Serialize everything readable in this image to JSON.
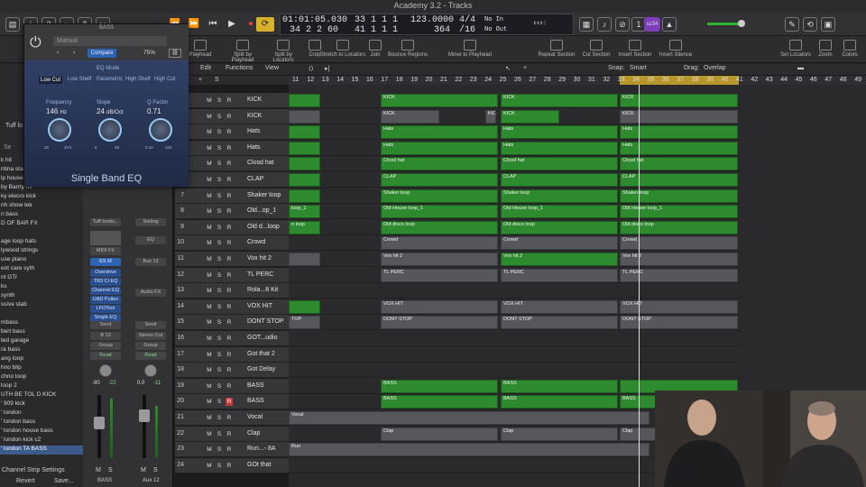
{
  "window": {
    "title": "Academy 3.2 - Tracks"
  },
  "transport": {
    "rewind": "⏪",
    "forward": "⏩",
    "to_start": "⏮",
    "play": "▶",
    "record": "●",
    "cycle": "⟳",
    "smpte": "01:01:05.030",
    "smpte_sub": "34 2 2 60",
    "bar_a": "33 1 1 1",
    "bar_b": "41 1 1 1",
    "tempo": "123.0000",
    "tempo_sub": "364",
    "sig": "4/4",
    "sig_sub": "/16",
    "in": "No In",
    "out": "No Out",
    "badge": "sz34"
  },
  "toolbar": {
    "tools": [
      "Playhead",
      "Split by Playhead",
      "Split by Locators",
      "Crop",
      "Stretch to Locators",
      "Join",
      "Bounce Regions",
      "Move to Playhead",
      "Repeat Section",
      "Cut Section",
      "Insert Section",
      "Insert Silence",
      "Set Locators",
      "Zoom",
      "Colors"
    ]
  },
  "library": {
    "items": [
      "k hit",
      "ntina stab",
      "lp house",
      "by Barrty riff",
      "ky elecro kick",
      "nh show tek",
      "n bass",
      "D OF BAR FX",
      "",
      "age loop hats",
      "lywood strings",
      "use piano",
      "ent care syth",
      "nt GTr",
      "ks",
      "synth",
      "ssive stab",
      "",
      "mbass",
      "bert bass",
      "ted garage",
      "ra bass",
      "ang loop",
      "hno blip",
      "chno loop",
      "loop 2",
      "UTH BE TOL D KICK",
      "' 909 kick",
      "' london",
      "' london bass",
      "' london house bass",
      "' london kick c2",
      "' london TA BASS"
    ],
    "selected_index": 32,
    "tuff_label": "Tuff lo",
    "search_label": "Se",
    "footer": "Channel Strip Settings",
    "revert": "Revert",
    "save": "Save..."
  },
  "inspector": {
    "left": {
      "preset": "Tuff londo...",
      "midi": "MIDI FX",
      "inst": "ES M",
      "plugins": [
        "Overdrive",
        "TR3 Ci EQ",
        "Channel EQ",
        "UAD Pultec",
        "LFOTool",
        "Single EQ"
      ],
      "send": "Send",
      "bus": "B 13",
      "group": "Group",
      "auto": "Read",
      "vol": "-90",
      "pan": "-22",
      "name": "BASS"
    },
    "right": {
      "setting": "Setting",
      "eq": "EQ",
      "bus": "Bus 13",
      "audio_fx": "Audio FX",
      "send": "Send",
      "output": "Stereo Out",
      "group": "Group",
      "auto": "Read",
      "vol": "0.0",
      "pan": "-11",
      "name": "Aux 12"
    }
  },
  "plugin": {
    "title": "BASS",
    "preset": "Manual",
    "compare": "Compare",
    "zoom": "75%",
    "eq_mode_label": "EQ Mode",
    "modes": [
      "Low Cut",
      "Low Shelf",
      "Parametric",
      "High Shelf",
      "High Cut"
    ],
    "params": [
      {
        "label": "Frequency",
        "value": "146",
        "unit": "Hz",
        "min": "20",
        "max": "20 k"
      },
      {
        "label": "Slope",
        "value": "24",
        "unit": "dB/Oct",
        "min": "6",
        "max": "48"
      },
      {
        "label": "Q Factor",
        "value": "0.71",
        "unit": "",
        "min": "0.10",
        "max": "100"
      }
    ],
    "name": "Single Band EQ"
  },
  "edit_bar": {
    "items": [
      "Edit",
      "Functions",
      "View"
    ],
    "snap_label": "Snap:",
    "snap_value": "Smart",
    "drag_label": "Drag:",
    "drag_value": "Overlap"
  },
  "ruler": {
    "bars": [
      "11",
      "12",
      "13",
      "14",
      "15",
      "16",
      "17",
      "18",
      "19",
      "20",
      "21",
      "22",
      "23",
      "24",
      "25",
      "26",
      "27",
      "28",
      "29",
      "30",
      "31",
      "32",
      "33",
      "34",
      "35",
      "36",
      "37",
      "38",
      "39",
      "40",
      "41",
      "42",
      "43",
      "44",
      "45",
      "46",
      "47",
      "48",
      "49"
    ]
  },
  "tracks": [
    {
      "num": "1",
      "name": "KICK",
      "rec": false,
      "regions": [
        {
          "text": "",
          "gray": false
        },
        {
          "text": "KICK",
          "gray": false
        },
        {
          "text": "KICK",
          "gray": false
        },
        {
          "text": "KICK",
          "gray": false
        }
      ]
    },
    {
      "num": "2",
      "name": "KICK",
      "rec": false,
      "regions": [
        {
          "text": "",
          "gray": true
        },
        {
          "text": "KICK",
          "gray": true
        },
        {
          "text": "KICK",
          "gray": true
        },
        {
          "text": "KICK",
          "gray": false
        },
        {
          "text": "KICK",
          "gray": true
        }
      ]
    },
    {
      "num": "3",
      "name": "Hats",
      "rec": false,
      "regions": [
        {
          "text": "",
          "gray": false
        },
        {
          "text": "Hats",
          "gray": false
        },
        {
          "text": "Hats",
          "gray": false
        },
        {
          "text": "Hats",
          "gray": false
        }
      ]
    },
    {
      "num": "4",
      "name": "Hats",
      "rec": false,
      "regions": [
        {
          "text": "",
          "gray": false
        },
        {
          "text": "Hats",
          "gray": false
        },
        {
          "text": "Hats",
          "gray": false
        },
        {
          "text": "Hats",
          "gray": false
        }
      ]
    },
    {
      "num": "5",
      "name": "Closd hat",
      "rec": false,
      "regions": [
        {
          "text": "",
          "gray": false
        },
        {
          "text": "Closd hat",
          "gray": false
        },
        {
          "text": "Closd hat",
          "gray": false
        },
        {
          "text": "Closd hat",
          "gray": false
        }
      ]
    },
    {
      "num": "6",
      "name": "CLAP",
      "rec": false,
      "regions": [
        {
          "text": "",
          "gray": false
        },
        {
          "text": "CLAP",
          "gray": false
        },
        {
          "text": "CLAP",
          "gray": false
        },
        {
          "text": "CLAP",
          "gray": false
        }
      ]
    },
    {
      "num": "7",
      "name": "Shaker loop",
      "rec": false,
      "regions": [
        {
          "text": "",
          "gray": false
        },
        {
          "text": "Shaker loop",
          "gray": false
        },
        {
          "text": "Shaker loop",
          "gray": false
        },
        {
          "text": "Shaker loop",
          "gray": false
        }
      ]
    },
    {
      "num": "8",
      "name": "Old...op_1",
      "rec": false,
      "regions": [
        {
          "text": "loop_1",
          "gray": false
        },
        {
          "text": "Old House loop_1",
          "gray": false
        },
        {
          "text": "Old House loop_1",
          "gray": false
        },
        {
          "text": "Old House loop_1",
          "gray": false
        }
      ]
    },
    {
      "num": "9",
      "name": "Old d...loop",
      "rec": false,
      "regions": [
        {
          "text": "o loop",
          "gray": false
        },
        {
          "text": "Old disco loop",
          "gray": false
        },
        {
          "text": "Old disco loop",
          "gray": false
        },
        {
          "text": "Old disco loop",
          "gray": false
        }
      ]
    },
    {
      "num": "10",
      "name": "Crowd",
      "rec": false,
      "regions": [
        {
          "text": "Crowd",
          "gray": true
        },
        {
          "text": "Crowd",
          "gray": true
        },
        {
          "text": "Crowd",
          "gray": true
        }
      ]
    },
    {
      "num": "11",
      "name": "Vox hit 2",
      "rec": false,
      "regions": [
        {
          "text": "",
          "gray": true
        },
        {
          "text": "Vox hit 2",
          "gray": true
        },
        {
          "text": "Vox hit 2",
          "gray": false
        },
        {
          "text": "Vox hit 2",
          "gray": true
        }
      ]
    },
    {
      "num": "12",
      "name": "TL PERC",
      "rec": false,
      "regions": [
        {
          "text": "TL PERC",
          "gray": true
        },
        {
          "text": "TL PERC",
          "gray": true
        },
        {
          "text": "TL PERC",
          "gray": true
        }
      ]
    },
    {
      "num": "13",
      "name": "Rola...8 Kit",
      "rec": false,
      "regions": []
    },
    {
      "num": "14",
      "name": "VOX HIT",
      "rec": false,
      "regions": [
        {
          "text": "",
          "gray": false
        },
        {
          "text": "VOX HIT",
          "gray": true
        },
        {
          "text": "VOX HIT",
          "gray": true
        },
        {
          "text": "VOX HIT",
          "gray": true
        }
      ]
    },
    {
      "num": "15",
      "name": "DONT STOP",
      "rec": false,
      "regions": [
        {
          "text": "TOP",
          "gray": true
        },
        {
          "text": "DONT STOP",
          "gray": true
        },
        {
          "text": "DONT STOP",
          "gray": true
        },
        {
          "text": "DONT STOP",
          "gray": true
        }
      ]
    },
    {
      "num": "16",
      "name": "GOT...udio",
      "rec": false,
      "regions": []
    },
    {
      "num": "17",
      "name": "Got that 2",
      "rec": false,
      "regions": []
    },
    {
      "num": "18",
      "name": "Got Delay",
      "rec": false,
      "regions": []
    },
    {
      "num": "19",
      "name": "BASS",
      "rec": false,
      "regions": [
        {
          "text": "BASS",
          "gray": false
        },
        {
          "text": "BASS",
          "gray": false
        },
        {
          "text": "",
          "gray": false
        }
      ]
    },
    {
      "num": "20",
      "name": "BASS",
      "rec": true,
      "regions": [
        {
          "text": "BASS",
          "gray": false
        },
        {
          "text": "BASS",
          "gray": false
        },
        {
          "text": "BASS",
          "gray": false
        }
      ]
    },
    {
      "num": "21",
      "name": "Vocal",
      "rec": false,
      "regions": [
        {
          "text": "Vocal",
          "gray": true
        }
      ]
    },
    {
      "num": "22",
      "name": "Clap",
      "rec": false,
      "regions": [
        {
          "text": "Clap",
          "gray": true
        },
        {
          "text": "Clap",
          "gray": true
        },
        {
          "text": "Clap",
          "gray": true
        }
      ]
    },
    {
      "num": "23",
      "name": "Run...- 8A",
      "rec": false,
      "regions": [
        {
          "text": "Run",
          "gray": true
        }
      ]
    },
    {
      "num": "24",
      "name": "GOt that",
      "rec": false,
      "regions": []
    }
  ],
  "colors": {
    "region_green": "#2e8a2e",
    "cycle_yellow": "#b8972a",
    "bg": "#1c1c1e"
  }
}
